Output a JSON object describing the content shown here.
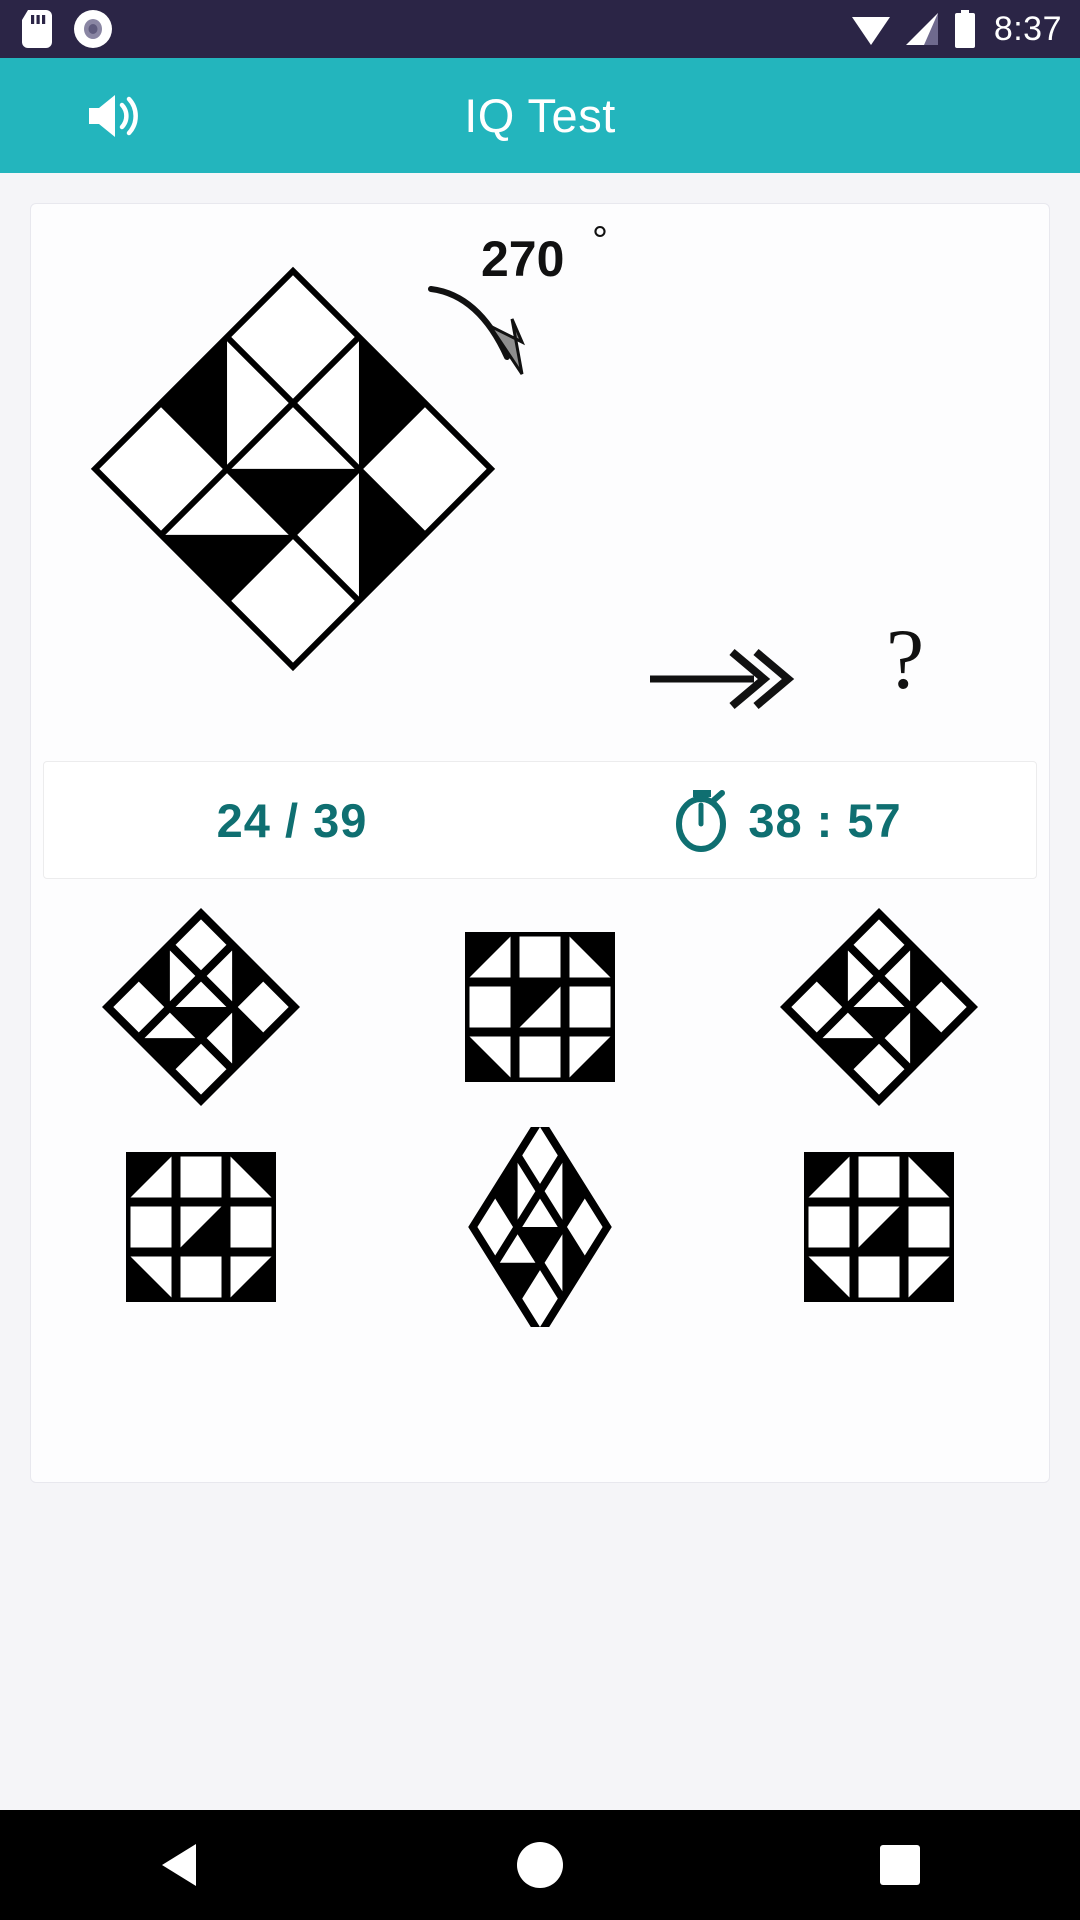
{
  "status_bar": {
    "time": "8:37",
    "icons": [
      "sd-card-icon",
      "record-icon",
      "wifi-icon",
      "cellular-signal-icon",
      "battery-icon"
    ],
    "background": "#2b2546"
  },
  "app_bar": {
    "title": "IQ Test",
    "volume_icon": "volume-up-icon",
    "background": "#23b5bd"
  },
  "question": {
    "rotation_label": "270",
    "degree_symbol": "°",
    "transform_arrow_icon": "double-chevron-right-arrow-icon",
    "rotation_arrow_icon": "curved-rotation-arrow-icon",
    "answer_placeholder": "?",
    "stimulus_description": "diamond-rotated 3x3 grid of black and white triangles"
  },
  "progress": {
    "counter": "24 / 39",
    "current": 24,
    "total": 39,
    "timer": "38 : 57",
    "timer_icon": "stopwatch-icon",
    "accent_color": "#0f6f71"
  },
  "options": [
    {
      "id": "option-1",
      "shape": "diamond",
      "label": "answer-option-1"
    },
    {
      "id": "option-2",
      "shape": "square",
      "label": "answer-option-2"
    },
    {
      "id": "option-3",
      "shape": "diamond",
      "label": "answer-option-3"
    },
    {
      "id": "option-4",
      "shape": "square",
      "label": "answer-option-4"
    },
    {
      "id": "option-5",
      "shape": "diamond-tall",
      "label": "answer-option-5"
    },
    {
      "id": "option-6",
      "shape": "square",
      "label": "answer-option-6"
    }
  ],
  "nav_bar": {
    "back": "back-triangle-icon",
    "home": "home-circle-icon",
    "recents": "recents-square-icon",
    "background": "#000000"
  }
}
